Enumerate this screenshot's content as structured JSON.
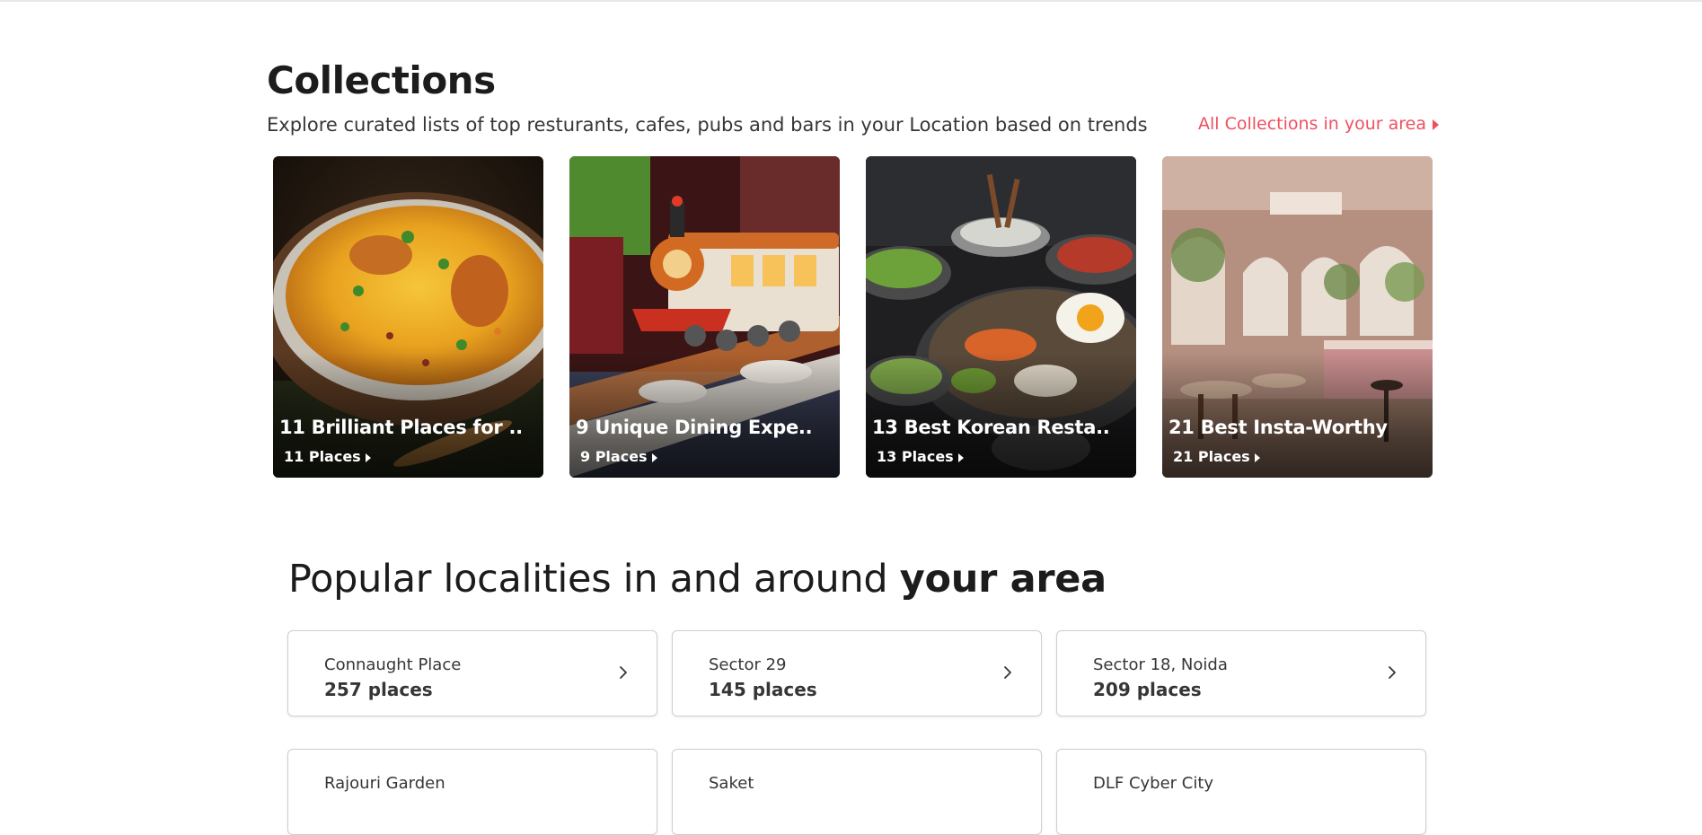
{
  "collections": {
    "heading": "Collections",
    "subtitle": "Explore curated lists of top resturants, cafes, pubs and bars in your Location based on trends",
    "all_link": "All Collections in your area",
    "cards": [
      {
        "title": "11 Brilliant Places for ..",
        "count": "11 Places"
      },
      {
        "title": "9 Unique Dining Expe..",
        "count": "9 Places"
      },
      {
        "title": "13 Best Korean Resta..",
        "count": "13 Places"
      },
      {
        "title": "21 Best Insta-Worthy",
        "count": "21 Places"
      }
    ]
  },
  "popular": {
    "heading_prefix": "Popular localities in and around ",
    "heading_bold": "your area",
    "localities": [
      {
        "name": "Connaught Place",
        "places": "257 places"
      },
      {
        "name": "Sector 29",
        "places": "145 places"
      },
      {
        "name": "Sector 18, Noida",
        "places": "209 places"
      },
      {
        "name": "Rajouri Garden",
        "places": ""
      },
      {
        "name": "Saket",
        "places": ""
      },
      {
        "name": "DLF Cyber City",
        "places": ""
      }
    ]
  },
  "colors": {
    "accent": "#ef4f5f",
    "text": "#1c1c1c"
  }
}
